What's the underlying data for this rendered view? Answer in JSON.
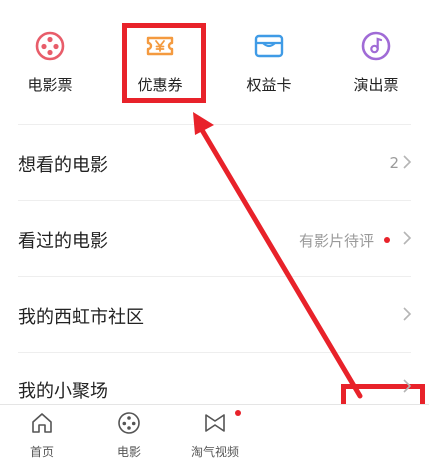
{
  "shortcuts": [
    {
      "label": "电影票",
      "icon": "film-reel-icon"
    },
    {
      "label": "优惠券",
      "icon": "coupon-yen-icon"
    },
    {
      "label": "权益卡",
      "icon": "wallet-card-icon"
    },
    {
      "label": "演出票",
      "icon": "music-disc-icon"
    }
  ],
  "list": [
    {
      "title": "想看的电影",
      "extra": "2"
    },
    {
      "title": "看过的电影",
      "extra": "有影片待评"
    },
    {
      "title": "我的西虹市社区",
      "extra": ""
    },
    {
      "title": "我的小聚场",
      "extra": ""
    }
  ],
  "tabbar": [
    {
      "label": "首页",
      "icon": "home-icon"
    },
    {
      "label": "电影",
      "icon": "film-reel-icon"
    },
    {
      "label": "淘气视频",
      "icon": "video-play-icon"
    }
  ],
  "colors": {
    "highlight": "#e8222a",
    "film_icon": "#e85d6a",
    "coupon_icon": "#f49a3f",
    "card_icon": "#3f9be6",
    "disc_icon": "#a06bd6"
  }
}
